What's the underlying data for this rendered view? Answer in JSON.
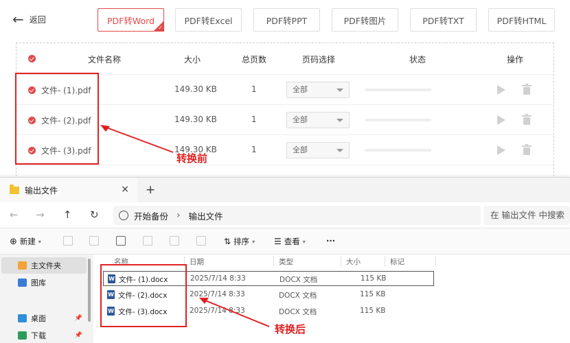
{
  "app": {
    "back_label": "返回",
    "tabs": [
      {
        "label": "PDF转Word",
        "active": true
      },
      {
        "label": "PDF转Excel",
        "active": false
      },
      {
        "label": "PDF转PPT",
        "active": false
      },
      {
        "label": "PDF转图片",
        "active": false
      },
      {
        "label": "PDF转TXT",
        "active": false
      },
      {
        "label": "PDF转HTML",
        "active": false
      }
    ],
    "table": {
      "headers": {
        "name": "文件名称",
        "size": "大小",
        "pages": "总页数",
        "page_select": "页码选择",
        "status": "状态",
        "action": "操作"
      },
      "rows": [
        {
          "name": "文件- (1).pdf",
          "size": "149.30 KB",
          "pages": "1",
          "page_select": "全部"
        },
        {
          "name": "文件- (2).pdf",
          "size": "149.30 KB",
          "pages": "1",
          "page_select": "全部"
        },
        {
          "name": "文件- (3).pdf",
          "size": "149.30 KB",
          "pages": "1",
          "page_select": "全部"
        }
      ]
    },
    "annotation_before": "转换前"
  },
  "explorer": {
    "tab_title": "输出文件",
    "new_tab": "+",
    "close": "×",
    "breadcrumb": [
      "开始备份",
      "输出文件"
    ],
    "search_placeholder": "在 输出文件 中搜索",
    "toolbar": {
      "new_label": "新建",
      "sort_label": "排序",
      "view_label": "查看",
      "more_label": "···"
    },
    "sidebar": [
      {
        "label": "主文件夹",
        "selected": true
      },
      {
        "label": "图库",
        "selected": false
      },
      {
        "label": "桌面",
        "selected": false
      },
      {
        "label": "下载",
        "selected": false
      }
    ],
    "columns": {
      "name": "名称",
      "date": "日期",
      "type": "类型",
      "size": "大小",
      "tags": "标记"
    },
    "files": [
      {
        "name": "文件- (1).docx",
        "date": "2025/7/14 8:33",
        "type": "DOCX 文档",
        "size": "115 KB"
      },
      {
        "name": "文件- (2).docx",
        "date": "2025/7/14 8:33",
        "type": "DOCX 文档",
        "size": "115 KB"
      },
      {
        "name": "文件- (3).docx",
        "date": "2025/7/14 8:33",
        "type": "DOCX 文档",
        "size": "115 KB"
      }
    ],
    "annotation_after": "转换后"
  },
  "colors": {
    "accent_red": "#e04a4a",
    "annotation_red": "#e02020",
    "word_blue": "#2b5797",
    "folder_yellow": "#f2c230"
  }
}
